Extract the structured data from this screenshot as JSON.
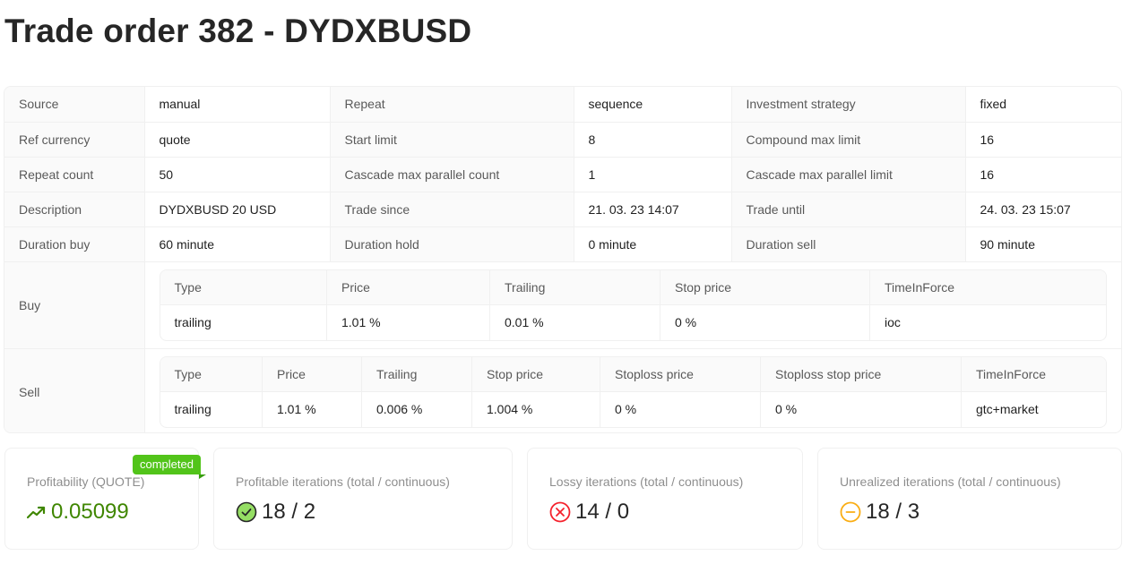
{
  "page": {
    "title": "Trade order 382 - DYDXBUSD"
  },
  "details": {
    "rows": [
      [
        {
          "label": "Source",
          "value": "manual"
        },
        {
          "label": "Repeat",
          "value": "sequence"
        },
        {
          "label": "Investment strategy",
          "value": "fixed"
        }
      ],
      [
        {
          "label": "Ref currency",
          "value": "quote"
        },
        {
          "label": "Start limit",
          "value": "8"
        },
        {
          "label": "Compound max limit",
          "value": "16"
        }
      ],
      [
        {
          "label": "Repeat count",
          "value": "50"
        },
        {
          "label": "Cascade max parallel count",
          "value": "1"
        },
        {
          "label": "Cascade max parallel limit",
          "value": "16"
        }
      ],
      [
        {
          "label": "Description",
          "value": "DYDXBUSD 20 USD"
        },
        {
          "label": "Trade since",
          "value": "21. 03. 23 14:07"
        },
        {
          "label": "Trade until",
          "value": "24. 03. 23 15:07"
        }
      ],
      [
        {
          "label": "Duration buy",
          "value": "60 minute"
        },
        {
          "label": "Duration hold",
          "value": "0 minute"
        },
        {
          "label": "Duration sell",
          "value": "90 minute"
        }
      ]
    ],
    "buy": {
      "label": "Buy",
      "headers": [
        "Type",
        "Price",
        "Trailing",
        "Stop price",
        "TimeInForce"
      ],
      "values": [
        "trailing",
        "1.01 %",
        "0.01 %",
        "0 %",
        "ioc"
      ]
    },
    "sell": {
      "label": "Sell",
      "headers": [
        "Type",
        "Price",
        "Trailing",
        "Stop price",
        "Stoploss price",
        "Stoploss stop price",
        "TimeInForce"
      ],
      "values": [
        "trailing",
        "1.01 %",
        "0.006 %",
        "1.004 %",
        "0 %",
        "0 %",
        "gtc+market"
      ]
    }
  },
  "stats": {
    "profitability": {
      "title": "Profitability (QUOTE)",
      "value": "0.05099",
      "badge": "completed",
      "icon": "rise-icon",
      "color": "#3f8600"
    },
    "profitable": {
      "title": "Profitable iterations (total / continuous)",
      "value": "18 / 2",
      "icon": "check-circle-icon",
      "color": "#52c41a"
    },
    "lossy": {
      "title": "Lossy iterations (total / continuous)",
      "value": "14 / 0",
      "icon": "close-circle-icon",
      "color": "#f5222d"
    },
    "unrealized": {
      "title": "Unrealized iterations (total / continuous)",
      "value": "18 / 3",
      "icon": "minus-circle-icon",
      "color": "#faad14"
    }
  }
}
